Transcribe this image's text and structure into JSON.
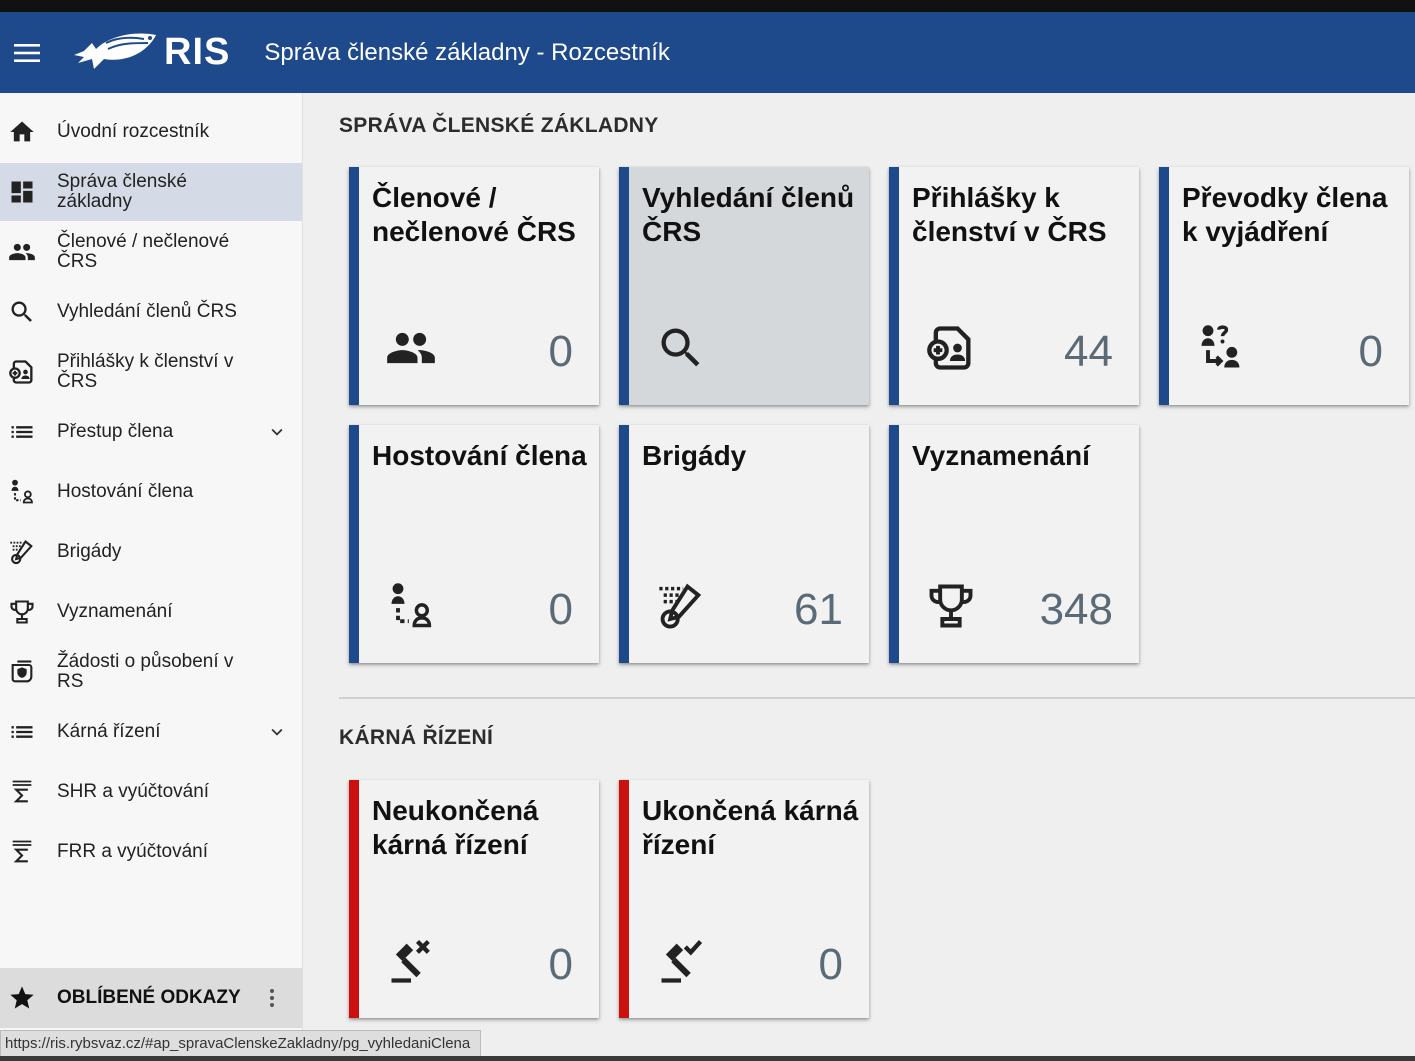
{
  "header": {
    "logo_text": "RIS",
    "title": "Správa členské základny - Rozcestník"
  },
  "sidebar": {
    "items": [
      {
        "label": "Úvodní rozcestník",
        "icon": "home-icon"
      },
      {
        "label": "Správa členské základny",
        "icon": "dashboard-icon",
        "active": true
      },
      {
        "label": "Členové / nečlenové ČRS",
        "icon": "people-icon"
      },
      {
        "label": "Vyhledání členů ČRS",
        "icon": "search-icon"
      },
      {
        "label": "Přihlášky k členství v ČRS",
        "icon": "application-icon"
      },
      {
        "label": "Přestup člena",
        "icon": "list-icon",
        "expandable": true
      },
      {
        "label": "Hostování člena",
        "icon": "transfer-person-icon"
      },
      {
        "label": "Brigády",
        "icon": "brigade-icon"
      },
      {
        "label": "Vyznamenání",
        "icon": "trophy-icon"
      },
      {
        "label": "Žádosti o působení v RS",
        "icon": "shield-icon"
      },
      {
        "label": "Kárná řízení",
        "icon": "list-icon",
        "expandable": true
      },
      {
        "label": "SHR a vyúčtování",
        "icon": "sigma-icon"
      },
      {
        "label": "FRR a vyúčtování",
        "icon": "sigma-icon"
      }
    ],
    "favorites_label": "OBLÍBENÉ ODKAZY"
  },
  "statusbar": {
    "text": "https://ris.rybsvaz.cz/#ap_spravaClenskeZakladny/pg_vyhledaniClena"
  },
  "sections": [
    {
      "title": "SPRÁVA ČLENSKÉ ZÁKLADNY",
      "cards": [
        {
          "title": "Členové / nečlenové ČRS",
          "count": "0",
          "icon": "people-icon"
        },
        {
          "title": "Vyhledání členů ČRS",
          "count": "",
          "icon": "search-icon"
        },
        {
          "title": "Přihlášky k členství v ČRS",
          "count": "44",
          "icon": "application-icon"
        },
        {
          "title": "Převodky člena k vyjádření",
          "count": "0",
          "icon": "person-question-icon"
        },
        {
          "title": "Hostování člena",
          "count": "0",
          "icon": "transfer-person-icon"
        },
        {
          "title": "Brigády",
          "count": "61",
          "icon": "brigade-icon"
        },
        {
          "title": "Vyznamenání",
          "count": "348",
          "icon": "trophy-icon"
        }
      ]
    },
    {
      "title": "KÁRNÁ ŘÍZENÍ",
      "cards": [
        {
          "title": "Neukončená kárná řízení",
          "count": "0",
          "icon": "gavel-x-icon"
        },
        {
          "title": "Ukončená kárná řízení",
          "count": "0",
          "icon": "gavel-check-icon"
        }
      ]
    }
  ],
  "colors": {
    "brand": "#1e4a8c",
    "alert": "#cc1010"
  }
}
